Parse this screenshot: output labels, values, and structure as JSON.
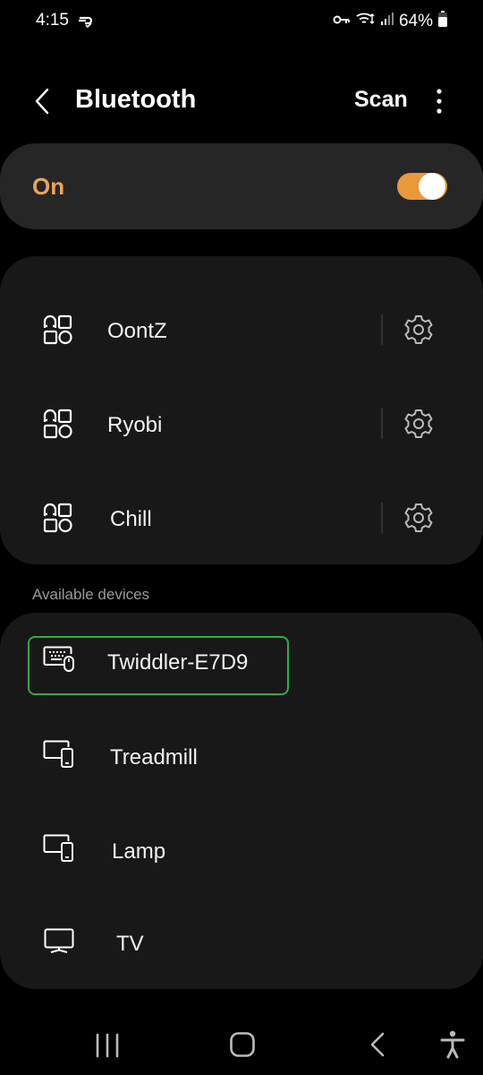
{
  "status_bar": {
    "time": "4:15",
    "battery_percent": "64%",
    "icons": [
      "link-icon",
      "vpn-key-icon",
      "wifi-icon",
      "signal-icon",
      "battery-icon"
    ]
  },
  "app_bar": {
    "title": "Bluetooth",
    "scan_label": "Scan",
    "back_icon": "chevron-left-icon",
    "more_icon": "more-vertical-icon"
  },
  "toggle": {
    "label": "On",
    "state": true,
    "accent_color": "#e8a55a"
  },
  "paired_devices": [
    {
      "name": "OontZ",
      "icon": "apps-icon",
      "settings_icon": "gear-icon"
    },
    {
      "name": "Ryobi",
      "icon": "apps-icon",
      "settings_icon": "gear-icon"
    },
    {
      "name": "Chill",
      "icon": "apps-icon",
      "settings_icon": "gear-icon"
    }
  ],
  "available_section": {
    "header": "Available devices",
    "devices": [
      {
        "name": "Twiddler-E7D9",
        "icon": "keyboard-mouse-icon",
        "highlighted": true
      },
      {
        "name": "Treadmill",
        "icon": "devices-icon"
      },
      {
        "name": "Lamp",
        "icon": "devices-icon"
      },
      {
        "name": "TV",
        "icon": "tv-icon"
      }
    ],
    "highlight_color": "#2fae46"
  },
  "nav_bar": {
    "recents_icon": "recents-icon",
    "home_icon": "home-icon",
    "back_icon": "back-icon",
    "accessibility_icon": "accessibility-icon"
  }
}
